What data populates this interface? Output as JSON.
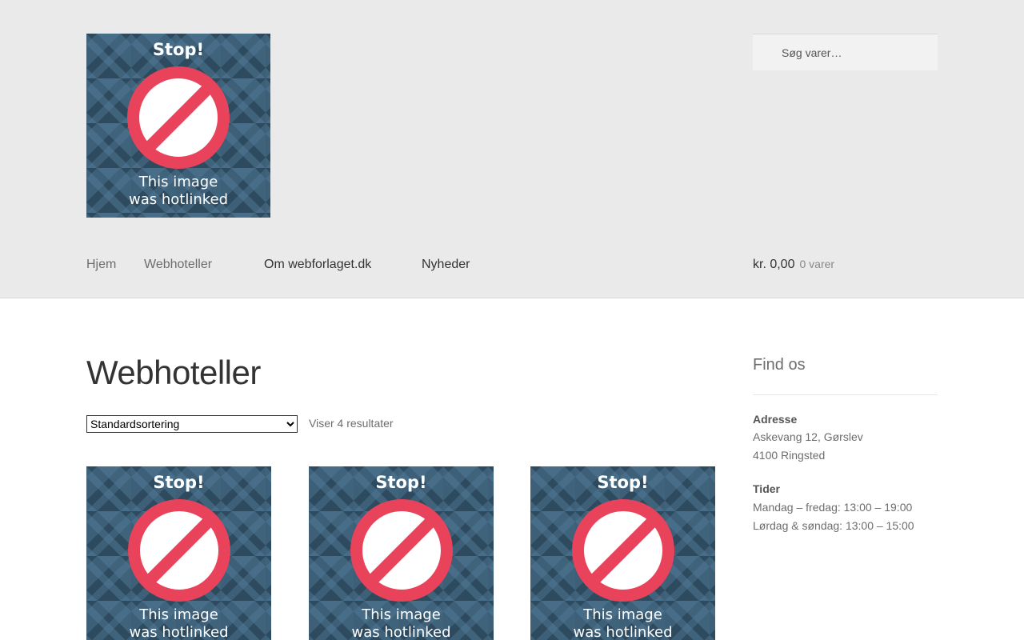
{
  "logo": {
    "stop": "Stop!",
    "line1": "This image",
    "line2": "was hotlinked"
  },
  "search": {
    "placeholder": "Søg varer…"
  },
  "nav": {
    "items": [
      "Hjem",
      "Webhoteller",
      "Om webforlaget.dk",
      "Nyheder"
    ]
  },
  "cart": {
    "amount": "kr. 0,00",
    "count": "0 varer"
  },
  "main": {
    "title": "Webhoteller",
    "ordering": {
      "selected": "Standardsortering"
    },
    "result_count": "Viser 4 resultater",
    "products": [
      {
        "stop": "Stop!",
        "line1": "This image",
        "line2": "was hotlinked"
      },
      {
        "stop": "Stop!",
        "line1": "This image",
        "line2": "was hotlinked"
      },
      {
        "stop": "Stop!",
        "line1": "This image",
        "line2": "was hotlinked"
      }
    ]
  },
  "sidebar": {
    "title": "Find os",
    "address_label": "Adresse",
    "address_line1": "Askevang 12, Gørslev",
    "address_line2": "4100 Ringsted",
    "hours_label": "Tider",
    "hours_line1": "Mandag – fredag: 13:00 – 19:00",
    "hours_line2": "Lørdag & søndag: 13:00 – 15:00"
  },
  "colors": {
    "header_bg": "#eaeaea",
    "stop_red": "#e8435a",
    "tile_blue": "#2d4a5e"
  }
}
